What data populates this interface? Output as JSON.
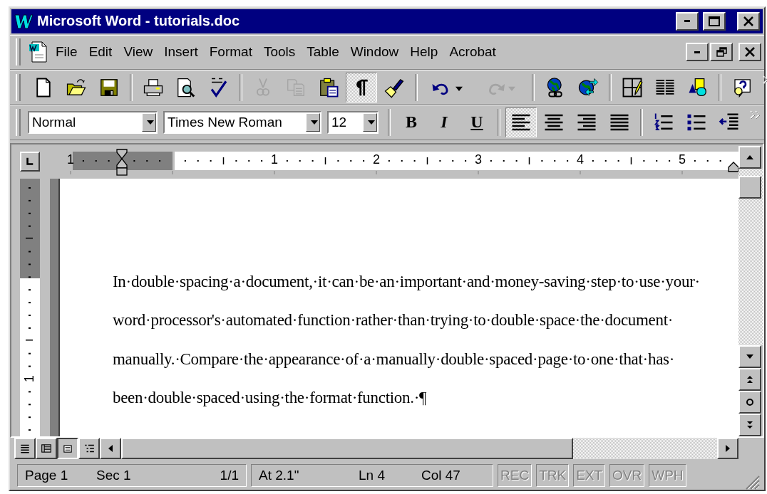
{
  "window": {
    "title": "Microsoft Word - tutorials.doc"
  },
  "menu": [
    "File",
    "Edit",
    "View",
    "Insert",
    "Format",
    "Tools",
    "Table",
    "Window",
    "Help",
    "Acrobat"
  ],
  "standard_toolbar": [
    {
      "kind": "new",
      "disabled": false,
      "pressed": false
    },
    {
      "kind": "open",
      "disabled": false,
      "pressed": false
    },
    {
      "kind": "save",
      "disabled": false,
      "pressed": false
    },
    {
      "kind": "separator"
    },
    {
      "kind": "print",
      "disabled": false,
      "pressed": false
    },
    {
      "kind": "preview",
      "disabled": false,
      "pressed": false
    },
    {
      "kind": "spelling",
      "disabled": false,
      "pressed": false
    },
    {
      "kind": "separator"
    },
    {
      "kind": "cut",
      "disabled": true,
      "pressed": false
    },
    {
      "kind": "copy",
      "disabled": true,
      "pressed": false
    },
    {
      "kind": "paste",
      "disabled": false,
      "pressed": false
    },
    {
      "kind": "show-marks",
      "disabled": false,
      "pressed": true
    },
    {
      "kind": "format-painter",
      "disabled": false,
      "pressed": false
    },
    {
      "kind": "separator"
    },
    {
      "kind": "undo",
      "disabled": false,
      "pressed": false
    },
    {
      "kind": "redo",
      "disabled": true,
      "pressed": false
    },
    {
      "kind": "separator"
    },
    {
      "kind": "hyperlink",
      "disabled": false,
      "pressed": false
    },
    {
      "kind": "web",
      "disabled": false,
      "pressed": false
    },
    {
      "kind": "separator"
    },
    {
      "kind": "tables",
      "disabled": false,
      "pressed": false
    },
    {
      "kind": "columns",
      "disabled": false,
      "pressed": false
    },
    {
      "kind": "drawing",
      "disabled": false,
      "pressed": false
    },
    {
      "kind": "separator"
    },
    {
      "kind": "help",
      "disabled": false,
      "pressed": false
    }
  ],
  "formatting_toolbar": {
    "style": "Normal",
    "font": "Times New Roman",
    "size": "12",
    "buttons": [
      {
        "kind": "bold",
        "label": "B",
        "pressed": false
      },
      {
        "kind": "italic",
        "label": "I",
        "pressed": false
      },
      {
        "kind": "underline",
        "label": "U",
        "pressed": false
      },
      {
        "kind": "separator"
      },
      {
        "kind": "align-left",
        "pressed": true
      },
      {
        "kind": "align-center",
        "pressed": false
      },
      {
        "kind": "align-right",
        "pressed": false
      },
      {
        "kind": "justify",
        "pressed": false
      },
      {
        "kind": "separator"
      },
      {
        "kind": "numbering",
        "pressed": false
      },
      {
        "kind": "bullets",
        "pressed": false
      },
      {
        "kind": "outdent",
        "pressed": false
      }
    ]
  },
  "ruler": {
    "labels": [
      "1",
      "1",
      "2",
      "3",
      "4",
      "5"
    ]
  },
  "vertical_ruler": {
    "labels": [
      "1"
    ]
  },
  "document": {
    "lines": [
      "In·double·spacing·a·document,·it·can·be·an·important·and·money-saving·step·to·use·your·",
      "word·processor's·automated·function·rather·than·trying·to·double·space·the·document·",
      "manually.·Compare·the·appearance·of·a·manually·double·spaced·page·to·one·that·has·",
      "been·double·spaced·using·the·format·function.·¶"
    ]
  },
  "view_buttons": [
    {
      "kind": "normal",
      "selected": false
    },
    {
      "kind": "web",
      "selected": false
    },
    {
      "kind": "print",
      "selected": true
    },
    {
      "kind": "outline",
      "selected": false
    }
  ],
  "status_bar": {
    "groups": [
      [
        "Page 1",
        "Sec 1",
        "1/1"
      ],
      [
        "At 2.1\"",
        "Ln 4",
        "Col 47"
      ]
    ],
    "indicators": [
      {
        "label": "REC",
        "disabled": true
      },
      {
        "label": "TRK",
        "disabled": true
      },
      {
        "label": "EXT",
        "disabled": true
      },
      {
        "label": "OVR",
        "disabled": true
      },
      {
        "label": "WPH",
        "disabled": true
      }
    ]
  }
}
